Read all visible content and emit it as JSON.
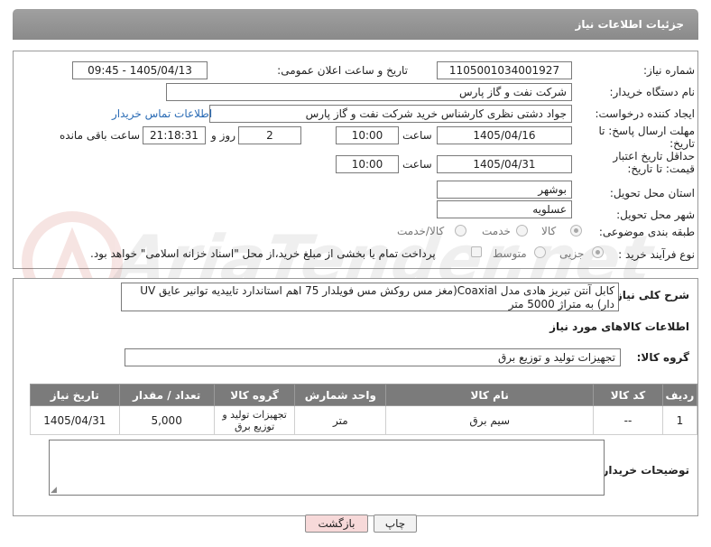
{
  "header": {
    "title": "جزئیات اطلاعات نیاز"
  },
  "fields": {
    "need_number_label": "شماره نیاز:",
    "need_number": "1105001034001927",
    "announce_label": "تاریخ و ساعت اعلان عمومی:",
    "announce_value": "1405/04/13 - 09:45",
    "buyer_org_label": "نام دستگاه خریدار:",
    "buyer_org": "شرکت نفت و گاز پارس",
    "creator_label": "ایجاد کننده درخواست:",
    "creator": "جواد دشتی نظری کارشناس خرید  شرکت نفت و گاز پارس",
    "contact_link": "اطلاعات تماس خریدار",
    "deadline_label": "مهلت ارسال پاسخ: تا تاریخ:",
    "deadline_date": "1405/04/16",
    "time_label": "ساعت",
    "deadline_time": "10:00",
    "days_value": "2",
    "days_label": "روز و",
    "remaining_time": "21:18:31",
    "remaining_label": "ساعت باقی مانده",
    "min_validity_label": "حداقل تاریخ اعتبار قیمت: تا تاریخ:",
    "min_validity_date": "1405/04/31",
    "min_validity_time": "10:00",
    "province_label": "استان محل تحویل:",
    "province": "بوشهر",
    "city_label": "شهر محل تحویل:",
    "city": "عسلویه",
    "category_label": "طبقه بندی موضوعی:",
    "category_options": [
      "کالا",
      "خدمت",
      "کالا/خدمت"
    ],
    "purchase_type_label": "نوع فرآیند خرید :",
    "purchase_options": [
      "جزیی",
      "متوسط"
    ],
    "payment_note": "پرداخت تمام یا بخشی از مبلغ خرید،از محل \"اسناد خزانه اسلامی\" خواهد بود."
  },
  "description": {
    "label": "شرح کلی نیاز:",
    "text": "کابل آنتن تبریز هادی مدل Coaxial(مغز مس روکش مس فویلدار 75 اهم استاندارد تاییدیه توانیر عایق UV دار) به متراژ 5000 متر"
  },
  "goods_info": {
    "title": "اطلاعات کالاهای مورد نیاز",
    "group_label": "گروه کالا:",
    "group_value": "تجهیزات تولید و توزیع برق"
  },
  "table": {
    "headers": [
      "ردیف",
      "کد کالا",
      "نام کالا",
      "واحد شمارش",
      "گروه کالا",
      "تعداد / مقدار",
      "تاریخ نیاز"
    ],
    "rows": [
      [
        "1",
        "--",
        "سیم برق",
        "متر",
        "تجهیزات تولید و توزیع برق",
        "5,000",
        "1405/04/31"
      ]
    ]
  },
  "buyer_notes": {
    "label": "توضیحات خریدار:",
    "value": ""
  },
  "buttons": {
    "print": "چاپ",
    "back": "بازگشت"
  },
  "colors": {
    "header_bg": "#8f8f8f",
    "table_header_bg": "#7b7b7b",
    "link": "#2a6bb5",
    "back_button_bg": "#f7d9d9"
  },
  "watermark": {
    "text": "AriaTender.net"
  }
}
